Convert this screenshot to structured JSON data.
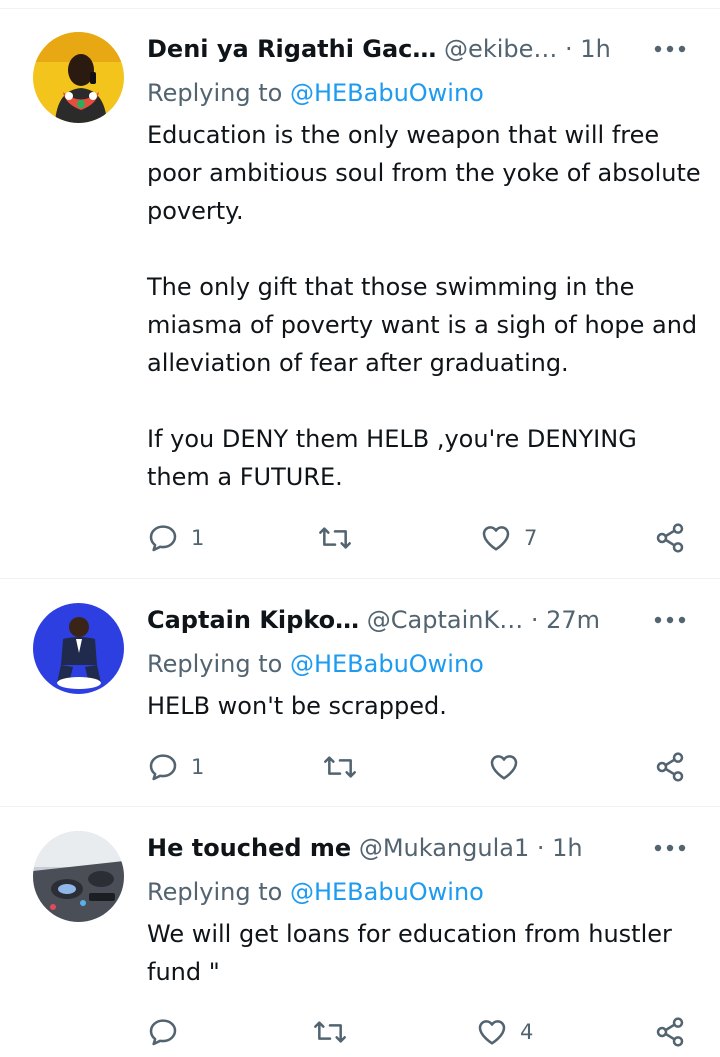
{
  "reply_prefix": "Replying to",
  "tweets": [
    {
      "name": "Deni ya Rigathi Gac…",
      "handle": "@ekibe…",
      "time": "1h",
      "replying_to": "@HEBabuOwino",
      "paragraphs": [
        "Education is the only weapon that will free poor ambitious soul from the yoke of absolute poverty.",
        "The only gift that those swimming in the miasma of poverty want is a sigh of hope and alleviation of fear after graduating.",
        "If you DENY them HELB ,you're DENYING them a FUTURE."
      ],
      "reply_count": "1",
      "retweet_count": "",
      "like_count": "7"
    },
    {
      "name": "Captain Kipko…",
      "handle": "@CaptainK…",
      "time": "27m",
      "replying_to": "@HEBabuOwino",
      "paragraphs": [
        "HELB won't be scrapped."
      ],
      "reply_count": "1",
      "retweet_count": "",
      "like_count": ""
    },
    {
      "name": "He touched me",
      "handle": "@Mukangula1",
      "time": "1h",
      "replying_to": "@HEBabuOwino",
      "paragraphs": [
        "We will get loans for education from hustler fund \""
      ],
      "reply_count": "",
      "retweet_count": "",
      "like_count": "4"
    }
  ],
  "colors": {
    "accent": "#1d9bf0",
    "secondary_text": "#536471",
    "divider": "#eff3f4"
  }
}
